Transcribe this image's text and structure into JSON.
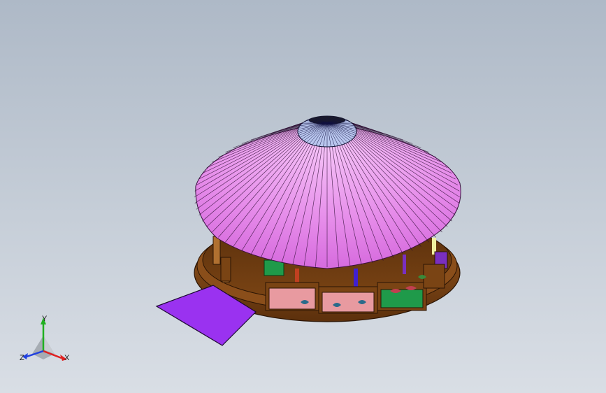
{
  "viewport": {
    "background_top": "#aeb9c7",
    "background_bottom": "#d9dee5"
  },
  "model": {
    "roof_color": "#e07ae6",
    "roof_highlight": "#f6c4f8",
    "crown_color": "#9fb8ea",
    "base_color": "#6b3a10",
    "platform_color": "#8a4a16",
    "ramp_color": "#9a32f0",
    "panel_colors": [
      "#e89aa0",
      "#e89aa0",
      "#1f9a4a",
      "#7a2fc0"
    ]
  },
  "triad": {
    "x_label": "X",
    "y_label": "Y",
    "z_label": "Z",
    "x_color": "#e02020",
    "y_color": "#20b020",
    "z_color": "#2040e0"
  }
}
